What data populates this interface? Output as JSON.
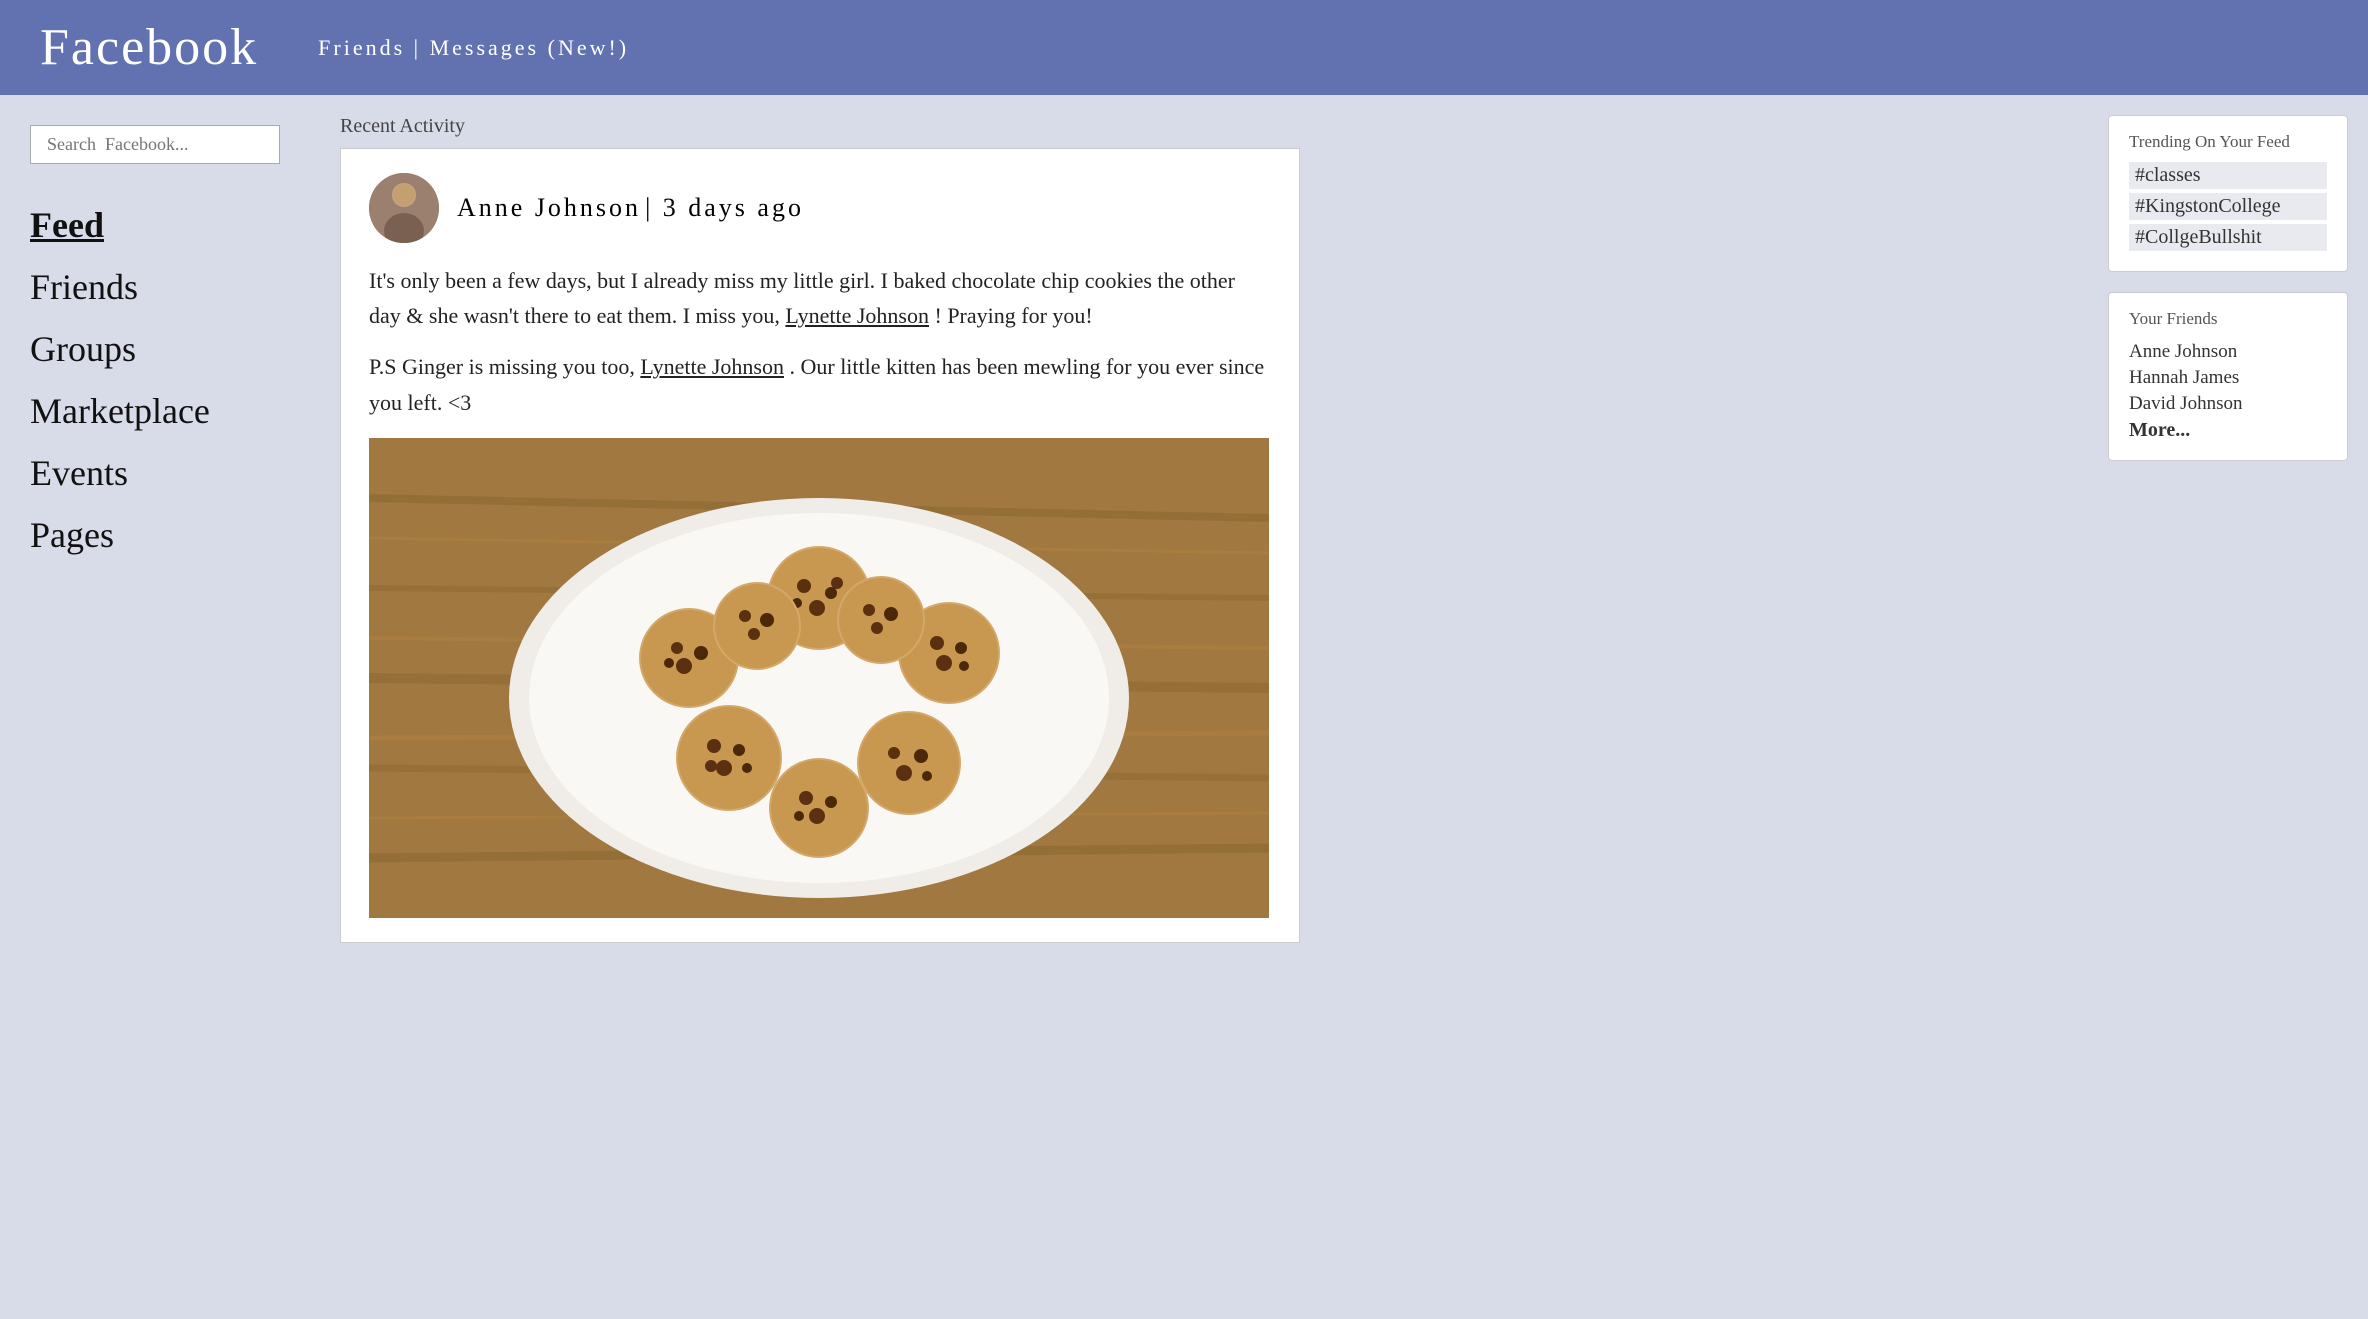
{
  "header": {
    "title": "Facebook",
    "nav": "Friends  |  Messages (New!)"
  },
  "sidebar": {
    "search_placeholder": "Search  Facebook...",
    "nav_items": [
      {
        "label": "Feed",
        "active": true
      },
      {
        "label": "Friends",
        "active": false
      },
      {
        "label": "Groups",
        "active": false
      },
      {
        "label": "Marketplace",
        "active": false
      },
      {
        "label": "Events",
        "active": false
      },
      {
        "label": "Pages",
        "active": false
      }
    ]
  },
  "main": {
    "recent_activity_label": "Recent Activity",
    "post": {
      "author": "Anne  Johnson",
      "timestamp": "|   3   days   ago",
      "body_line1": "It's only been a few days, but I already miss my little girl. I baked chocolate chip cookies the other day & she wasn't there to eat them. I miss you,",
      "link1": "Lynette Johnson",
      "body_line2": "! Praying for you!",
      "body_line3": "P.S Ginger is missing you too,",
      "link2": "Lynette Johnson",
      "body_line4": ". Our little kitten has been mewling for you ever since you left. <3"
    }
  },
  "right_sidebar": {
    "trending_title": "Trending On Your Feed",
    "trending_tags": [
      "#classes",
      "#KingstonCollege",
      "#CollgeBullshit"
    ],
    "friends_title": "Your Friends",
    "friends": [
      {
        "name": "Anne Johnson",
        "bold": false
      },
      {
        "name": "Hannah James",
        "bold": false
      },
      {
        "name": "David Johnson",
        "bold": false
      },
      {
        "name": "More...",
        "bold": true
      }
    ]
  }
}
